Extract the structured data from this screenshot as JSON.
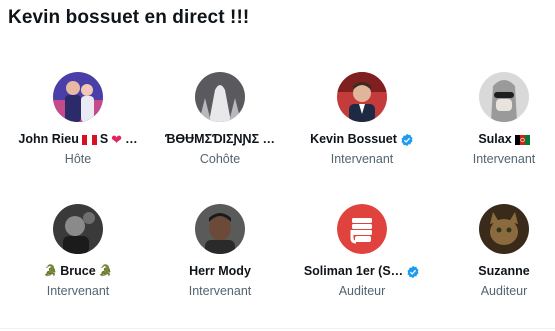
{
  "title": "Kevin bossuet en direct !!!",
  "participants": [
    {
      "name": "John Rieu",
      "suffix": "S",
      "ellipsis": "…",
      "role": "Hôte"
    },
    {
      "name": "ƁƟɄMƩƊƖƩƝƝƩ …",
      "role": "Cohôte"
    },
    {
      "name": "Kevin Bossuet",
      "role": "Intervenant"
    },
    {
      "name": "Sulax",
      "role": "Intervenant"
    },
    {
      "name": "Bruce",
      "role": "Intervenant"
    },
    {
      "name": "Herr Mody",
      "role": "Intervenant"
    },
    {
      "name": "Soliman 1er (S…",
      "role": "Auditeur"
    },
    {
      "name": "Suzanne",
      "role": "Auditeur"
    }
  ],
  "colors": {
    "verified": "#1d9bf0",
    "secondary_text": "#536471",
    "spaces_icon_bg": "#e0433d"
  }
}
